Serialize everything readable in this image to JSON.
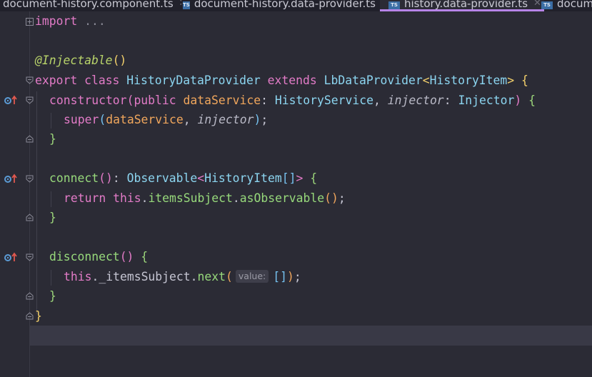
{
  "tabs": [
    {
      "label": "document-history.component.ts",
      "icon": "",
      "active": false
    },
    {
      "label": "document-history.data-provider.ts",
      "icon": "TS",
      "active": false
    },
    {
      "label": "history.data-provider.ts",
      "icon": "TS",
      "active": true
    },
    {
      "label": "docum",
      "icon": "TS",
      "active": false
    }
  ],
  "code": {
    "import_kw": "import",
    "import_rest": " ...",
    "decorator": "@Injectable",
    "decorator_parens": "()",
    "export_kw": "export",
    "class_kw": " class ",
    "class_name": "HistoryDataProvider",
    "extends_kw": " extends ",
    "base_class": "LbDataProvider",
    "generic_open": "<",
    "generic_type": "HistoryItem",
    "generic_close": ">",
    "brace_open": " {",
    "constructor_name": "constructor",
    "paren_open": "(",
    "public_kw": "public",
    "param1": " dataService",
    "colon1": ": ",
    "type1": "HistoryService",
    "comma1": ", ",
    "param2": "injector",
    "colon2": ": ",
    "type2": "Injector",
    "paren_close": ")",
    "ctor_brace": " {",
    "super_kw": "super",
    "super_open": "(",
    "super_arg1": "dataService",
    "super_comma": ", ",
    "super_arg2": "injector",
    "super_close": ")",
    "semi": ";",
    "close_brace": "}",
    "connect_name": "connect",
    "connect_parens": "()",
    "connect_colon": ": ",
    "observable": "Observable",
    "obs_open": "<",
    "obs_type": "HistoryItem",
    "obs_arr": "[]",
    "obs_close": ">",
    "connect_brace": " {",
    "return_kw": "return",
    "this_kw": " this",
    "dot1": ".",
    "items_subject": "itemsSubject",
    "dot2": ".",
    "as_observable": "asObservable",
    "as_obs_parens": "()",
    "semi2": ";",
    "disconnect_name": "disconnect",
    "disconnect_parens": "()",
    "disconnect_brace": " {",
    "this2": "this",
    "dot3": ".",
    "private_subject": "_itemsSubject",
    "dot4": ".",
    "next_fn": "next",
    "next_open": "(",
    "hint_label": "value:",
    "next_arg": "[]",
    "next_close": ")",
    "semi3": ";",
    "class_close": "}"
  },
  "colors": {
    "keyword": "#e27bc7",
    "class_name": "#8cd5f0",
    "function": "#97d97b",
    "parameter": "#f0a65c",
    "accent_tab": "#b784e8",
    "override_marker": "#e0584f",
    "override_circle": "#5b9bd5"
  },
  "icons": [
    "ts-file-icon",
    "close-icon",
    "override-method-icon",
    "fold-icon"
  ]
}
